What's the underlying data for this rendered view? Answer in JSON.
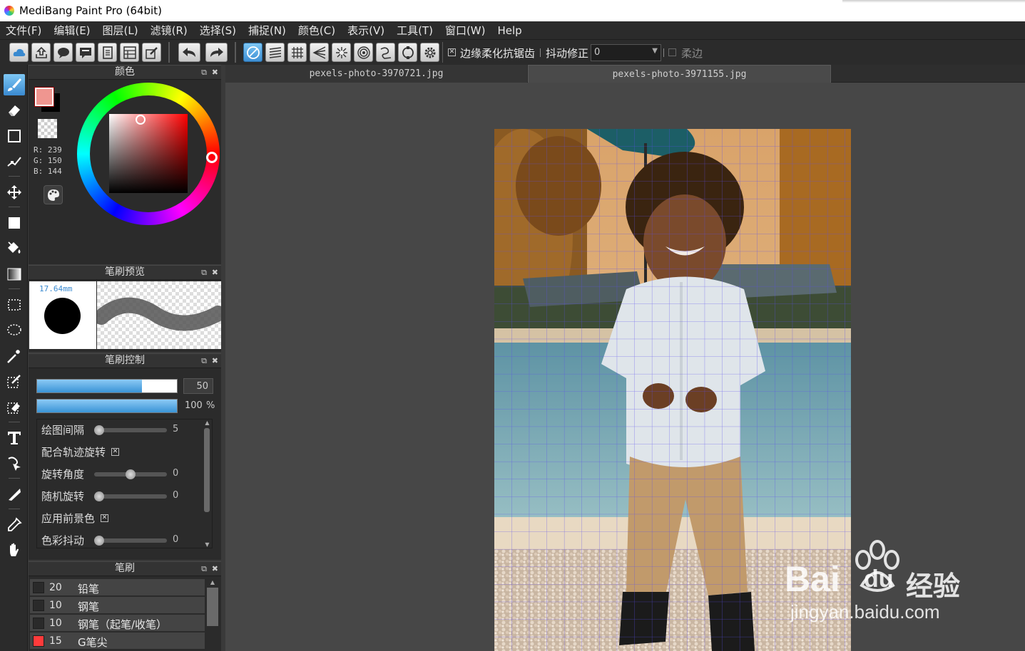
{
  "app": {
    "title": "MediBang Paint Pro (64bit)"
  },
  "menu": [
    "文件(F)",
    "编辑(E)",
    "图层(L)",
    "滤镜(R)",
    "选择(S)",
    "捕捉(N)",
    "颜色(C)",
    "表示(V)",
    "工具(T)",
    "窗口(W)",
    "Help"
  ],
  "toolbar": {
    "antialias_label": "边缘柔化抗锯齿",
    "antialias_checked": true,
    "stabilizer_label": "抖动修正",
    "stabilizer_value": "0",
    "soft_edge_label": "柔边",
    "soft_edge_checked": false
  },
  "color_panel": {
    "title": "颜色",
    "r": "R: 239",
    "g": "G: 150",
    "b": "B: 144",
    "foreground": "#ef9690",
    "background": "#000000"
  },
  "brush_preview": {
    "title": "笔刷预览",
    "size": "17.64mm"
  },
  "brush_control": {
    "title": "笔刷控制",
    "size_value": "50",
    "size_fraction": 0.75,
    "opacity_value": "100",
    "opacity_unit": "%",
    "opacity_fraction": 1.0,
    "options": [
      {
        "label": "绘图间隔",
        "type": "slider",
        "value": "5",
        "fraction": 0.0
      },
      {
        "label": "配合轨迹旋转",
        "type": "checkbox",
        "checked": true
      },
      {
        "label": "旋转角度",
        "type": "slider",
        "value": "0",
        "fraction": 0.5
      },
      {
        "label": "随机旋转",
        "type": "slider",
        "value": "0",
        "fraction": 0.0
      },
      {
        "label": "应用前景色",
        "type": "checkbox",
        "checked": true
      },
      {
        "label": "色彩抖动",
        "type": "slider",
        "value": "0",
        "fraction": 0.0
      }
    ]
  },
  "brush_list": {
    "title": "笔刷",
    "items": [
      {
        "size": "20",
        "name": "铅笔",
        "color": "#2a2a2a"
      },
      {
        "size": "10",
        "name": "钢笔",
        "color": "#2a2a2a"
      },
      {
        "size": "10",
        "name": "钢笔（起笔/收笔）",
        "color": "#2a2a2a"
      },
      {
        "size": "15",
        "name": "G笔尖",
        "color": "#ff3b3b"
      }
    ]
  },
  "documents": {
    "tabs": [
      "pexels-photo-3970721.jpg",
      "pexels-photo-3971155.jpg"
    ],
    "active_tab": 1
  },
  "watermark": {
    "brand": "Bai",
    "brand2": "du",
    "cn": "经验",
    "url": "jingyan.baidu.com"
  }
}
